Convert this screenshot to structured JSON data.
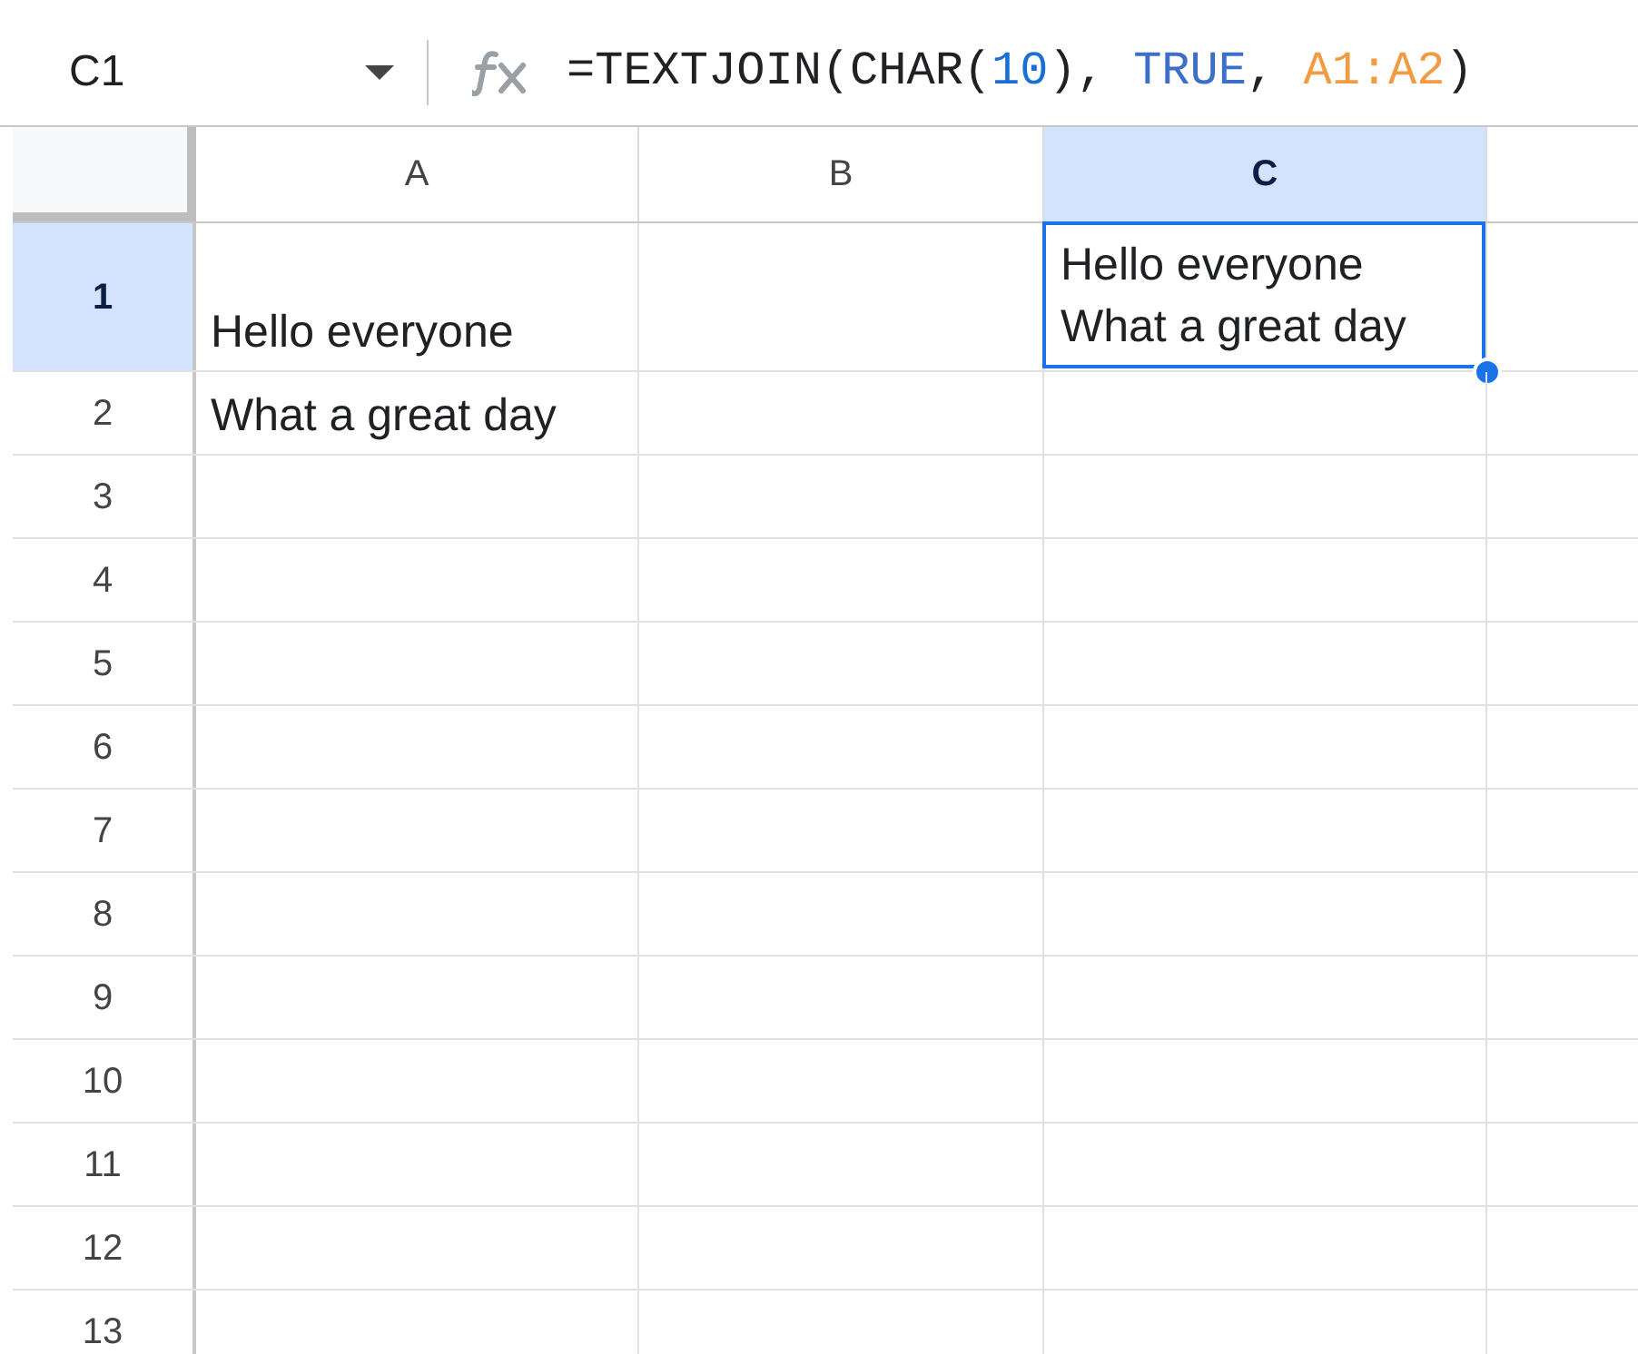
{
  "name_box": {
    "value": "C1"
  },
  "formula": [
    {
      "kind": "plain",
      "text": "=TEXTJOIN(CHAR("
    },
    {
      "kind": "number",
      "text": "10"
    },
    {
      "kind": "plain",
      "text": "), "
    },
    {
      "kind": "bool",
      "text": "TRUE"
    },
    {
      "kind": "plain",
      "text": ", "
    },
    {
      "kind": "range",
      "text": "A1:A2"
    },
    {
      "kind": "plain",
      "text": ")"
    }
  ],
  "columns": [
    {
      "label": "A",
      "selected": false
    },
    {
      "label": "B",
      "selected": false
    },
    {
      "label": "C",
      "selected": true
    }
  ],
  "rows": [
    {
      "label": "1",
      "selected": true,
      "cells": [
        {
          "lines": [
            "Hello everyone"
          ],
          "selected": false
        },
        null,
        {
          "lines": [
            "Hello everyone",
            "What a great day"
          ],
          "selected": true
        }
      ]
    },
    {
      "label": "2",
      "selected": false,
      "cells": [
        {
          "lines": [
            "What a great day"
          ],
          "selected": false
        }
      ]
    },
    {
      "label": "3",
      "selected": false
    },
    {
      "label": "4",
      "selected": false
    },
    {
      "label": "5",
      "selected": false
    },
    {
      "label": "6",
      "selected": false
    },
    {
      "label": "7",
      "selected": false
    },
    {
      "label": "8",
      "selected": false
    },
    {
      "label": "9",
      "selected": false
    },
    {
      "label": "10",
      "selected": false
    },
    {
      "label": "11",
      "selected": false
    },
    {
      "label": "12",
      "selected": false
    },
    {
      "label": "13",
      "selected": false
    }
  ]
}
